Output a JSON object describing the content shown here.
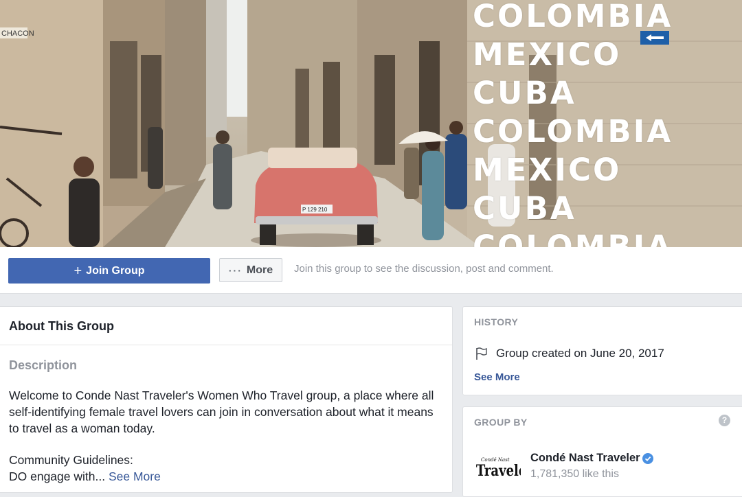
{
  "cover": {
    "overlay_words": [
      "COLOMBIA",
      "MEXICO",
      "CUBA",
      "COLOMBIA",
      "MEXICO",
      "CUBA",
      "COLOMBIA"
    ],
    "street_sign_text": "CHACON",
    "plate_text": "P 129 210"
  },
  "action_bar": {
    "join_label": "Join Group",
    "more_label": "More",
    "hint": "Join this group to see the discussion, post and comment."
  },
  "about": {
    "title": "About This Group",
    "description_heading": "Description",
    "description": "Welcome to Conde Nast Traveler's Women Who Travel group, a place where all self-identifying female travel lovers can join in conversation about what it means to travel as a woman today.",
    "guidelines_line1": "Community Guidelines:",
    "guidelines_line2": "DO engage with...",
    "see_more": "See More"
  },
  "history": {
    "title": "HISTORY",
    "created": "Group created on June 20, 2017",
    "see_more": "See More"
  },
  "group_by": {
    "title": "GROUP BY",
    "page_name": "Condé Nast Traveler",
    "likes": "1,781,350 like this",
    "logo_small": "Condé Nast",
    "logo_big": "Traveler"
  },
  "colors": {
    "primary": "#4267b2",
    "link": "#385898",
    "muted": "#90949c",
    "background": "#e9ebee"
  }
}
